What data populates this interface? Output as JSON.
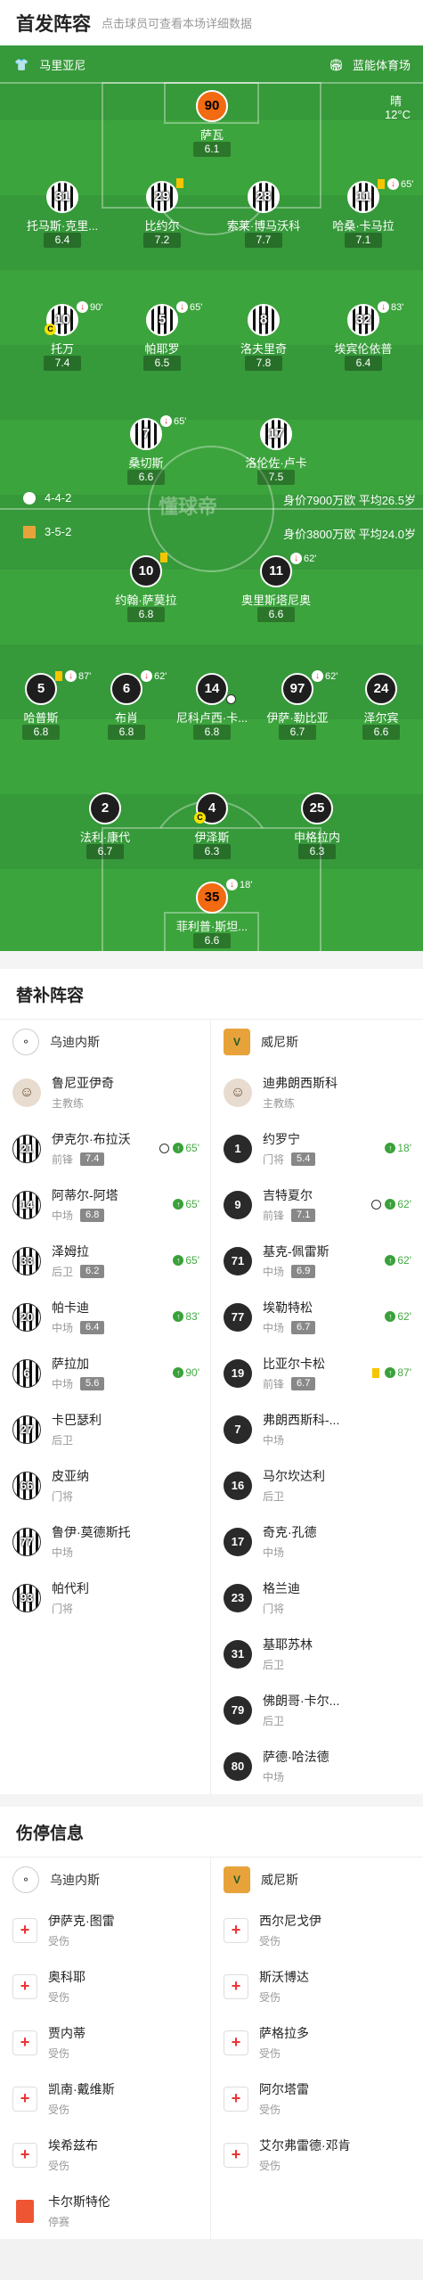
{
  "header": {
    "title": "首发阵容",
    "subtitle": "点击球员可查看本场详细数据"
  },
  "pitch": {
    "home_team": "马里亚尼",
    "venue": "蓝能体育场",
    "weather": "晴",
    "temp": "12°C",
    "watermark": "懂球帝",
    "home_formation": "4-4-2",
    "home_info": "身价7900万欧 平均26.5岁",
    "away_formation": "3-5-2",
    "away_info": "身价3800万欧 平均24.0岁",
    "home_players": [
      {
        "num": "90",
        "name": "萨瓦",
        "rating": "6.1"
      },
      {
        "num": "31",
        "name": "托马斯·克里...",
        "rating": "6.4"
      },
      {
        "num": "29",
        "name": "比约尔",
        "rating": "7.2",
        "ev": "yc"
      },
      {
        "num": "28",
        "name": "索莱·博马沃科",
        "rating": "7.7"
      },
      {
        "num": "11",
        "name": "哈桑·卡马拉",
        "rating": "7.1",
        "ev": "65'"
      },
      {
        "num": "10",
        "name": "托万",
        "rating": "7.4",
        "ev": "90'"
      },
      {
        "num": "5",
        "name": "帕耶罗",
        "rating": "6.5",
        "ev": "65'"
      },
      {
        "num": "8",
        "name": "洛夫里奇",
        "rating": "7.8"
      },
      {
        "num": "32",
        "name": "埃宾伦依普",
        "rating": "6.4",
        "ev": "83'"
      },
      {
        "num": "7",
        "name": "桑切斯",
        "rating": "6.6",
        "ev": "65'"
      },
      {
        "num": "17",
        "name": "洛伦佐·卢卡",
        "rating": "7.5"
      }
    ],
    "away_players": [
      {
        "num": "10",
        "name": "约翰·萨莫拉",
        "rating": "6.8"
      },
      {
        "num": "11",
        "name": "奥里斯塔尼奥",
        "rating": "6.6",
        "ev": "62'"
      },
      {
        "num": "5",
        "name": "哈普斯",
        "rating": "6.8",
        "ev": "87'"
      },
      {
        "num": "6",
        "name": "布肖",
        "rating": "6.8",
        "ev": "62'"
      },
      {
        "num": "14",
        "name": "尼科卢西·卡...",
        "rating": "6.8"
      },
      {
        "num": "97",
        "name": "伊萨·勒比亚",
        "rating": "6.7",
        "ev": "62'"
      },
      {
        "num": "24",
        "name": "泽尔宾",
        "rating": "6.6"
      },
      {
        "num": "2",
        "name": "法利·康代",
        "rating": "6.7"
      },
      {
        "num": "4",
        "name": "伊泽斯",
        "rating": "6.3"
      },
      {
        "num": "25",
        "name": "申格拉内",
        "rating": "6.3"
      },
      {
        "num": "35",
        "name": "菲利普·斯坦...",
        "rating": "6.6",
        "ev": "18'"
      }
    ]
  },
  "subs": {
    "title": "替补阵容",
    "home": {
      "team": "乌迪内斯",
      "coach": "鲁尼亚伊奇",
      "coach_role": "主教练",
      "players": [
        {
          "num": "21",
          "name": "伊克尔·布拉沃",
          "pos": "前锋",
          "rating": "7.4",
          "time": "65'"
        },
        {
          "num": "14",
          "name": "阿蒂尔-阿塔",
          "pos": "中场",
          "rating": "6.8",
          "time": "65'"
        },
        {
          "num": "33",
          "name": "泽姆拉",
          "pos": "后卫",
          "rating": "6.2",
          "time": "65'"
        },
        {
          "num": "20",
          "name": "帕卡迪",
          "pos": "中场",
          "rating": "6.4",
          "time": "83'"
        },
        {
          "num": "6",
          "name": "萨拉加",
          "pos": "中场",
          "rating": "5.6",
          "time": "90'"
        },
        {
          "num": "27",
          "name": "卡巴瑟利",
          "pos": "后卫"
        },
        {
          "num": "66",
          "name": "皮亚纳",
          "pos": "门将"
        },
        {
          "num": "77",
          "name": "鲁伊·莫德斯托",
          "pos": "中场"
        },
        {
          "num": "93",
          "name": "帕代利",
          "pos": "门将"
        }
      ]
    },
    "away": {
      "team": "威尼斯",
      "coach": "迪弗朗西斯科",
      "coach_role": "主教练",
      "players": [
        {
          "num": "1",
          "name": "约罗宁",
          "pos": "门将",
          "rating": "5.4",
          "time": "18'"
        },
        {
          "num": "9",
          "name": "吉特夏尔",
          "pos": "前锋",
          "rating": "7.1",
          "time": "62'"
        },
        {
          "num": "71",
          "name": "基克-佩雷斯",
          "pos": "中场",
          "rating": "6.9",
          "time": "62'"
        },
        {
          "num": "77",
          "name": "埃勒特松",
          "pos": "中场",
          "rating": "6.7",
          "time": "62'"
        },
        {
          "num": "19",
          "name": "比亚尔卡松",
          "pos": "前锋",
          "rating": "6.7",
          "time": "87'"
        },
        {
          "num": "7",
          "name": "弗朗西斯科-...",
          "pos": "中场"
        },
        {
          "num": "16",
          "name": "马尔坎达利",
          "pos": "后卫"
        },
        {
          "num": "17",
          "name": "奇克·孔德",
          "pos": "中场"
        },
        {
          "num": "23",
          "name": "格兰迪",
          "pos": "门将"
        },
        {
          "num": "31",
          "name": "基耶苏林",
          "pos": "后卫"
        },
        {
          "num": "79",
          "name": "佛朗哥·卡尔...",
          "pos": "后卫"
        },
        {
          "num": "80",
          "name": "萨德·哈法德",
          "pos": "中场"
        }
      ]
    }
  },
  "injuries": {
    "title": "伤停信息",
    "home": {
      "team": "乌迪内斯",
      "players": [
        {
          "name": "伊萨克·图雷",
          "status": "受伤"
        },
        {
          "name": "奥科耶",
          "status": "受伤"
        },
        {
          "name": "贾内蒂",
          "status": "受伤"
        },
        {
          "name": "凯南·戴维斯",
          "status": "受伤"
        },
        {
          "name": "埃希兹布",
          "status": "受伤"
        },
        {
          "name": "卡尔斯特伦",
          "status": "停赛"
        }
      ]
    },
    "away": {
      "team": "威尼斯",
      "players": [
        {
          "name": "西尔尼戈伊",
          "status": "受伤"
        },
        {
          "name": "斯沃博达",
          "status": "受伤"
        },
        {
          "name": "萨格拉多",
          "status": "受伤"
        },
        {
          "name": "阿尔塔雷",
          "status": "受伤"
        },
        {
          "name": "艾尔弗雷德·邓肯",
          "status": "受伤"
        }
      ]
    }
  }
}
